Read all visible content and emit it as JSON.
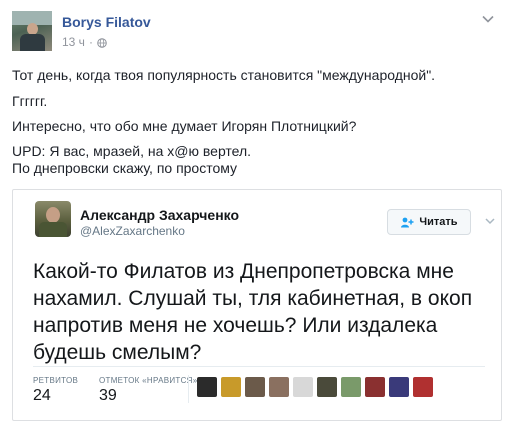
{
  "post": {
    "author": "Borys Filatov",
    "time": "13 ч",
    "separator": "·",
    "lines": [
      "Тот день, когда твоя популярность становится \"международной\".",
      "Гггггг.",
      "Интересно, что обо мне думает Игорян Плотницкий?",
      "UPD: Я вас, мразей, на х@ю вертел.",
      "По днепровски скажу, по простому"
    ]
  },
  "tweet": {
    "name": "Александр Захарченко",
    "handle": "@AlexZaxarchenko",
    "follow_label": "Читать",
    "text": "Какой-то Филатов из Днепропетровска мне нахамил. Слушай ты, тля кабинетная, в окоп напротив меня не хочешь? Или издалека будешь смелым?",
    "retweets_label": "РЕТВИТОВ",
    "retweets": "24",
    "likes_label": "ОТМЕТОК «НРАВИТСЯ»",
    "likes": "39",
    "liker_colors": [
      "#2b2b2b",
      "#c89a2a",
      "#6b5a4a",
      "#8a7060",
      "#d8d8d8",
      "#4a4a3a",
      "#7a9a6a",
      "#8a3030",
      "#3a3a7a",
      "#b03030"
    ]
  },
  "colors": {
    "link": "#365899",
    "meta": "#90949c",
    "twitter_blue": "#1da1f2"
  }
}
